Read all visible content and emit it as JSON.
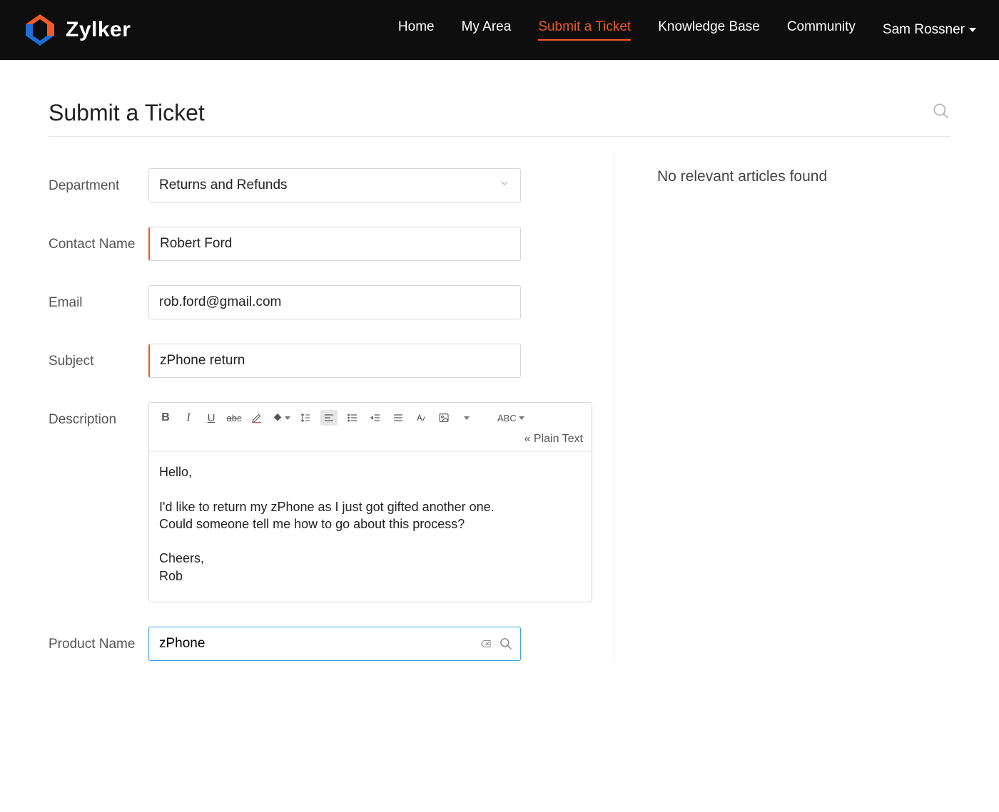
{
  "brand": {
    "name": "Zylker"
  },
  "nav": {
    "items": [
      {
        "label": "Home",
        "active": false
      },
      {
        "label": "My Area",
        "active": false
      },
      {
        "label": "Submit a Ticket",
        "active": true
      },
      {
        "label": "Knowledge Base",
        "active": false
      },
      {
        "label": "Community",
        "active": false
      }
    ],
    "user": "Sam Rossner"
  },
  "page": {
    "title": "Submit a Ticket"
  },
  "sidebar": {
    "message": "No relevant articles found"
  },
  "form": {
    "department": {
      "label": "Department",
      "value": "Returns and Refunds"
    },
    "contact_name": {
      "label": "Contact Name",
      "value": "Robert Ford"
    },
    "email": {
      "label": "Email",
      "value": "rob.ford@gmail.com"
    },
    "subject": {
      "label": "Subject",
      "value": "zPhone return"
    },
    "description": {
      "label": "Description",
      "body": "Hello,\n\nI'd like to return my zPhone as I just got gifted another one.\nCould someone tell me how to go about this process?\n\nCheers,\nRob"
    },
    "product_name": {
      "label": "Product Name",
      "value": "zPhone"
    }
  },
  "editor_toolbar": {
    "spellcheck_label": "ABC",
    "plain_text_label": "« Plain Text"
  }
}
